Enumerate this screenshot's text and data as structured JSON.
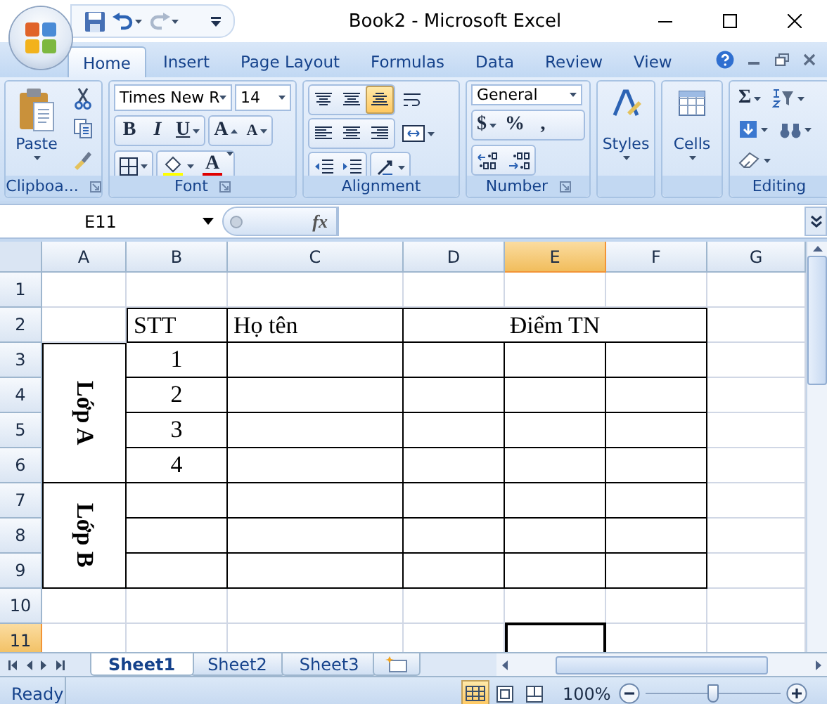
{
  "title_bar": {
    "title": "Book2 - Microsoft Excel"
  },
  "tabs": [
    {
      "label": "Home",
      "selected": true
    },
    {
      "label": "Insert",
      "selected": false
    },
    {
      "label": "Page Layout",
      "selected": false
    },
    {
      "label": "Formulas",
      "selected": false
    },
    {
      "label": "Data",
      "selected": false
    },
    {
      "label": "Review",
      "selected": false
    },
    {
      "label": "View",
      "selected": false
    }
  ],
  "ribbon": [
    {
      "kind": "clipboard",
      "label": "Clipboa...",
      "paste": "Paste"
    },
    {
      "kind": "font",
      "label": "Font",
      "font_name": "Times New R",
      "font_size": "14",
      "bold": "B",
      "italic": "I",
      "underline": "U",
      "grow": "A",
      "shrink": "A",
      "font_color": "A"
    },
    {
      "kind": "alignment",
      "label": "Alignment",
      "vertical": [
        {
          "selected": false
        },
        {
          "selected": false
        },
        {
          "selected": true
        }
      ],
      "horizontal": [
        {
          "selected": false
        },
        {
          "selected": false
        },
        {
          "selected": false
        }
      ]
    },
    {
      "kind": "number",
      "label": "Number",
      "format": "General",
      "currency": "$",
      "percent": "%",
      "comma": ","
    },
    {
      "kind": "styles",
      "label": "Styles"
    },
    {
      "kind": "cells",
      "label": "Cells"
    },
    {
      "kind": "editing",
      "label": "Editing",
      "sum": "Σ"
    }
  ],
  "formula_bar": {
    "name_box": "E11",
    "function_label": "fx"
  },
  "sheet": {
    "columns": [
      {
        "label": "A",
        "selected": false
      },
      {
        "label": "B",
        "selected": false
      },
      {
        "label": "C",
        "selected": false
      },
      {
        "label": "D",
        "selected": false
      },
      {
        "label": "E",
        "selected": true
      },
      {
        "label": "F",
        "selected": false
      },
      {
        "label": "G",
        "selected": false
      }
    ],
    "rows": [
      {
        "label": "1",
        "selected": false
      },
      {
        "label": "2",
        "selected": false
      },
      {
        "label": "3",
        "selected": false
      },
      {
        "label": "4",
        "selected": false
      },
      {
        "label": "5",
        "selected": false
      },
      {
        "label": "6",
        "selected": false
      },
      {
        "label": "7",
        "selected": false
      },
      {
        "label": "8",
        "selected": false
      },
      {
        "label": "9",
        "selected": false
      },
      {
        "label": "10",
        "selected": false
      },
      {
        "label": "11",
        "selected": true
      }
    ],
    "table": {
      "headers": [
        "STT",
        "Họ tên",
        "Điểm TN"
      ],
      "groups": [
        {
          "label": "Lớp A",
          "rows": [
            {
              "stt": "1"
            },
            {
              "stt": "2"
            },
            {
              "stt": "3"
            },
            {
              "stt": "4"
            }
          ]
        },
        {
          "label": "Lớp B",
          "rows": [
            {},
            {},
            {}
          ]
        }
      ]
    }
  },
  "sheet_tabs": [
    {
      "label": "Sheet1",
      "selected": true
    },
    {
      "label": "Sheet2",
      "selected": false
    },
    {
      "label": "Sheet3",
      "selected": false
    }
  ],
  "status_bar": {
    "status": "Ready",
    "views": [
      {
        "selected": true
      },
      {
        "selected": false
      },
      {
        "selected": false
      }
    ],
    "zoom": "100%",
    "zoom_slider": {
      "level": 0.5
    }
  }
}
